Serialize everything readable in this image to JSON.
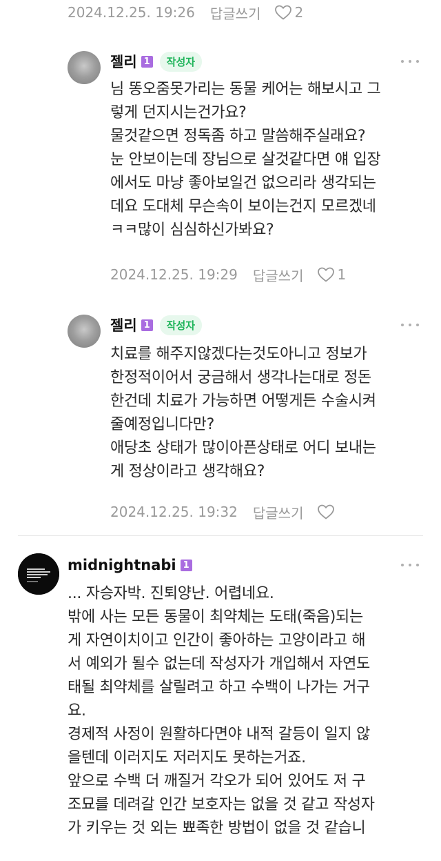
{
  "top_comment_meta": {
    "date": "2024.12.25. 19:26",
    "reply_label": "답글쓰기",
    "like_count": "2"
  },
  "reply1": {
    "author": "젤리",
    "level": "1",
    "author_badge": "작성자",
    "lines": [
      "님 똥오줌못가리는 동물 케어는 해보시고 그",
      "렇게 던지시는건가요?",
      "물것같으면 정독좀 하고 말씀해주실래요?",
      "눈 안보이는데 장님으로 살것같다면 얘 입장",
      "에서도 마냥 좋아보일건 없으리라 생각되는",
      "데요 도대체 무슨속이 보이는건지 모르겠네",
      "ㅋㅋ많이 심심하신가봐요?"
    ],
    "date": "2024.12.25. 19:29",
    "reply_label": "답글쓰기",
    "like_count": "1"
  },
  "reply2": {
    "author": "젤리",
    "level": "1",
    "author_badge": "작성자",
    "lines": [
      "치료를 해주지않겠다는것도아니고 정보가",
      "한정적이어서 궁금해서 생각나는대로 정돈",
      "한건데 치료가 가능하면 어떻게든 수술시켜",
      "줄예정입니다만?",
      "애당초 상태가 많이아픈상태로 어디 보내는",
      "게 정상이라고 생각해요?"
    ],
    "date": "2024.12.25. 19:32",
    "reply_label": "답글쓰기",
    "like_count": ""
  },
  "comment3": {
    "author": "midnightnabi",
    "level": "1",
    "lines": [
      "... 자승자박. 진퇴양난. 어렵네요.",
      "밖에 사는 모든 동물이 최약체는 도태(죽음)되는",
      "게 자연이치이고 인간이 좋아하는 고양이라고 해",
      "서 예외가 될수 없는데 작성자가 개입해서 자연도",
      "태될 최약체를 살릴려고 하고 수백이 나가는 거구",
      "요.",
      "경제적 사정이 원활하다면야 내적 갈등이 일지 않",
      "을텐데 이러지도 저러지도 못하는거죠.",
      "앞으로 수백 더 깨질거 각오가 되어 있어도 저 구",
      "조묘를 데려갈 인간 보호자는 없을 것 같고 작성자",
      "가 키우는 것 외는 뾰족한 방법이 없을 것 같습니"
    ]
  },
  "colors": {
    "meta_gray": "#9a9a9a",
    "badge_green_text": "#1eb45a",
    "badge_green_bg": "#e7f8ed",
    "level_purple": "#a96ce0"
  },
  "icons": [
    "heart-icon",
    "more-options-icon",
    "level-badge-icon"
  ]
}
